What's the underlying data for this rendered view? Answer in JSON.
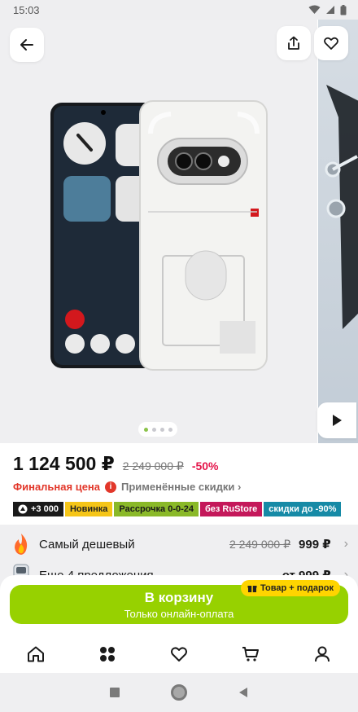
{
  "status_bar": {
    "time": "15:03"
  },
  "gallery": {
    "dots_total": 4,
    "active_index": 0
  },
  "price": {
    "current": "1 124 500 ₽",
    "old": "2 249 000 ₽",
    "discount": "-50%",
    "final_label": "Финальная цена",
    "applied_discounts": "Применённые скидки"
  },
  "tags": [
    {
      "label": "+3 000"
    },
    {
      "label": "Новинка"
    },
    {
      "label": "Рассрочка 0-0-24"
    },
    {
      "label": "без RuStore"
    },
    {
      "label": "скидки до -90%"
    }
  ],
  "offers": [
    {
      "label": "Самый дешевый",
      "old_price": "2 249 000 ₽",
      "price": "999 ₽"
    },
    {
      "label": "Еще 4 предложения",
      "price": "от 999 ₽"
    }
  ],
  "cart": {
    "label": "В корзину",
    "sublabel": "Только онлайн-оплата",
    "gift_badge": "Товар + подарок"
  },
  "colors": {
    "accent_green": "#97d100",
    "sale_red": "#e4154a",
    "gift_yellow": "#ffd400"
  }
}
